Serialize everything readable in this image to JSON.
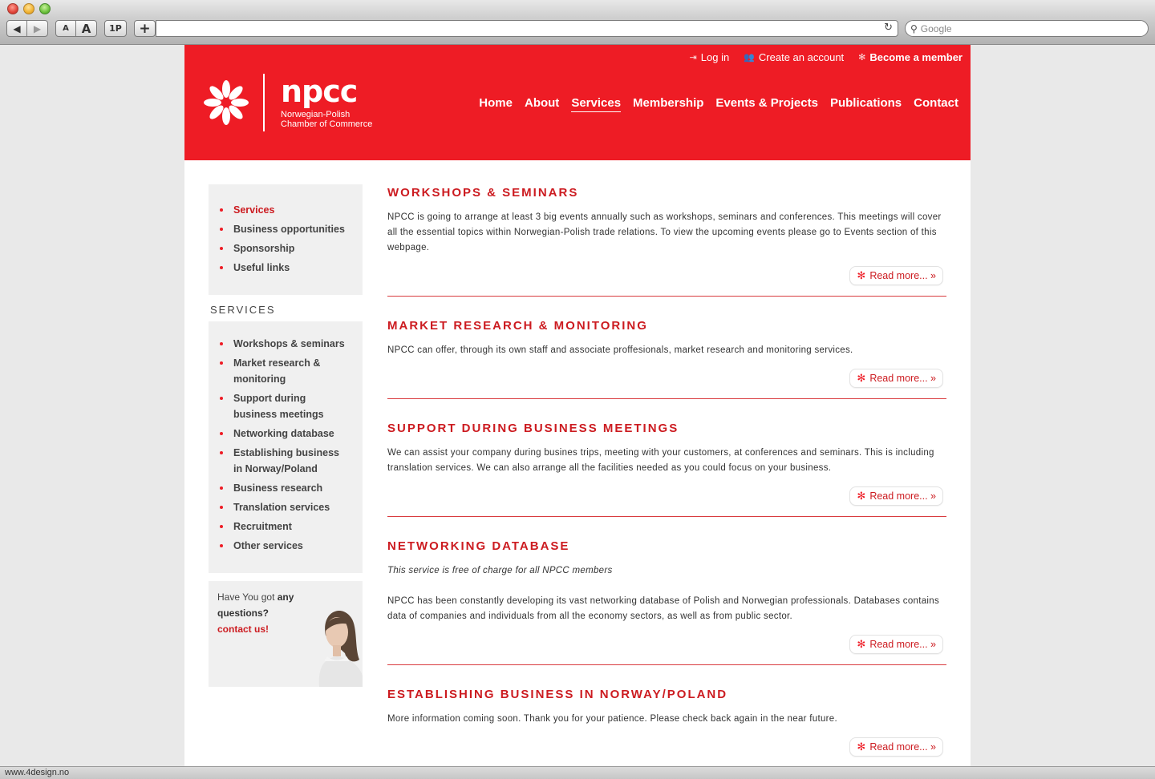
{
  "browser": {
    "search_placeholder": "Google",
    "buttons": {
      "back": "◀",
      "forward": "▶",
      "font_small": "A",
      "font_big": "A",
      "onep": "1P",
      "add_tab": "+"
    },
    "status_url": "www.4design.no"
  },
  "header": {
    "toplinks": {
      "login": "Log in",
      "create_account": "Create an account",
      "become_member": "Become a member"
    },
    "logo": {
      "name": "npcc",
      "sub_line1": "Norwegian-Polish",
      "sub_line2": "Chamber of Commerce"
    },
    "nav": [
      "Home",
      "About",
      "Services",
      "Membership",
      "Events & Projects",
      "Publications",
      "Contact"
    ],
    "active_nav": "Services"
  },
  "sidebar": {
    "top_menu": [
      "Services",
      "Business opportunities",
      "Sponsorship",
      "Useful links"
    ],
    "services_heading": "SERVICES",
    "services_menu": [
      "Workshops & seminars",
      "Market research & monitoring",
      "Support during business meetings",
      "Networking database",
      "Establishing business in Norway/Poland",
      "Business research",
      "Translation services",
      "Recruitment",
      "Other services"
    ],
    "questions": {
      "prefix": "Have You got ",
      "bold1": "any",
      "bold2": "questions?",
      "cta": "contact us!"
    }
  },
  "entries": [
    {
      "title": "WORKSHOPS & SEMINARS",
      "body": "NPCC is going to arrange at least 3 big events annually such as workshops, seminars and conferences. This meetings will cover all the essential topics within Norwegian-Polish trade relations. To view the upcoming events please go to Events section of this webpage.",
      "read_more": "Read more... »"
    },
    {
      "title": "MARKET RESEARCH & MONITORING",
      "body": "NPCC can offer, through its own staff and associate proffesionals, market research and monitoring services.",
      "read_more": "Read more... »"
    },
    {
      "title": "SUPPORT DURING BUSINESS MEETINGS",
      "body": "We can assist your company during busines trips, meeting with your customers, at conferences and seminars. This is including translation services. We can also arrange all the facilities needed as you could focus on your business.",
      "read_more": "Read more... »"
    },
    {
      "title": "NETWORKING DATABASE",
      "note": "This service is free of charge for all NPCC members",
      "body": "NPCC has been constantly developing its vast networking database of Polish and Norwegian professionals. Databases contains data of companies and individuals from all the economy sectors, as well as from public sector.",
      "read_more": "Read more... »"
    },
    {
      "title": "ESTABLISHING BUSINESS IN NORWAY/POLAND",
      "body": "More information coming soon. Thank you for your patience. Please check back again in the near future.",
      "read_more": "Read more... »"
    }
  ],
  "colors": {
    "brand_red": "#ee1c25",
    "link_red": "#cc1b20",
    "sidebar_bg": "#f0f0f0"
  }
}
